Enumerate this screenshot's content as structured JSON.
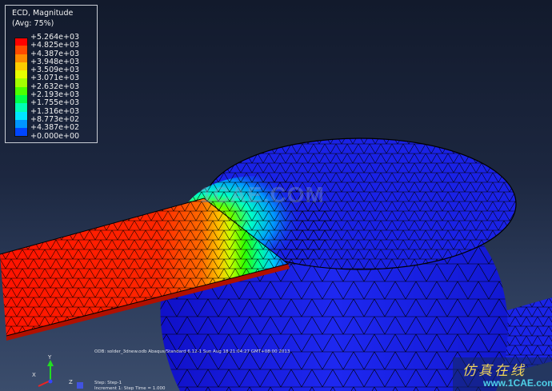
{
  "legend": {
    "title": "ECD, Magnitude",
    "subtitle": "(Avg: 75%)",
    "levels": [
      {
        "label": "+5.264e+03",
        "color": "#ff0000"
      },
      {
        "label": "+4.825e+03",
        "color": "#ff4a00"
      },
      {
        "label": "+4.387e+03",
        "color": "#ff8c00"
      },
      {
        "label": "+3.948e+03",
        "color": "#ffcc00"
      },
      {
        "label": "+3.509e+03",
        "color": "#e6ff00"
      },
      {
        "label": "+3.071e+03",
        "color": "#a4ff00"
      },
      {
        "label": "+2.632e+03",
        "color": "#4cff00"
      },
      {
        "label": "+2.193e+03",
        "color": "#00ff4a"
      },
      {
        "label": "+1.755e+03",
        "color": "#00ffb4"
      },
      {
        "label": "+1.316e+03",
        "color": "#00e6ff"
      },
      {
        "label": "+8.773e+02",
        "color": "#0096ff"
      },
      {
        "label": "+4.387e+02",
        "color": "#0046ff"
      },
      {
        "label": "+0.000e+00",
        "color": "#0000ff"
      }
    ]
  },
  "info": {
    "odb_line": "ODB: solder_3dnew.odb    Abaqus/Standard 6.12-1    Sun Aug 18 21:04:27 GMT+08:00 2013",
    "step_line": "Step: Step-1",
    "increment_line": "Increment    1: Step Time =    1.000"
  },
  "triad": {
    "x": "X",
    "y": "Y",
    "z": "Z"
  },
  "watermark": "1CAE.COM",
  "brand": {
    "cn": "仿真在线",
    "url": "www.1CAE.com"
  },
  "colors": {
    "mesh_blue": "#1a22e6",
    "trace_red": "#ff1a00",
    "edge": "#000000"
  }
}
